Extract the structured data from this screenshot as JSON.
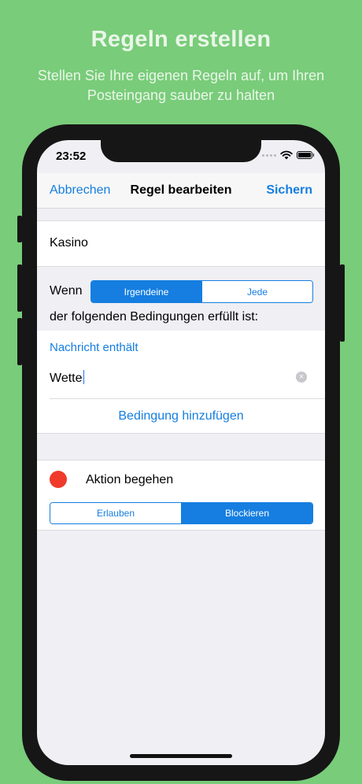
{
  "hero": {
    "title": "Regeln erstellen",
    "subtitle_line1": "Stellen Sie Ihre eigenen Regeln auf, um Ihren",
    "subtitle_line2": "Posteingang sauber zu halten"
  },
  "status_bar": {
    "time": "23:52",
    "icons": [
      "signal-dots-icon",
      "wifi-icon",
      "battery-icon"
    ]
  },
  "navbar": {
    "cancel_label": "Abbrechen",
    "title": "Regel bearbeiten",
    "save_label": "Sichern"
  },
  "rule": {
    "name_value": "Kasino",
    "when_label": "Wenn",
    "match_segment": {
      "options": [
        "Irgendeine",
        "Jede"
      ],
      "selected": "Irgendeine"
    },
    "conditions_suffix": "der folgenden Bedingungen erfüllt ist:"
  },
  "condition": {
    "type_label": "Nachricht enthält",
    "value": "Wette",
    "clear_icon": "clear-circle-icon",
    "add_label": "Bedingung hinzufügen"
  },
  "action": {
    "label": "Aktion begehen",
    "color_dot": "#f03a2c",
    "segment": {
      "options": [
        "Erlauben",
        "Blockieren"
      ],
      "selected": "Blockieren"
    }
  },
  "colors": {
    "background": "#79cc7a",
    "accent": "#157ee0",
    "action_dot": "#f03a2c"
  }
}
